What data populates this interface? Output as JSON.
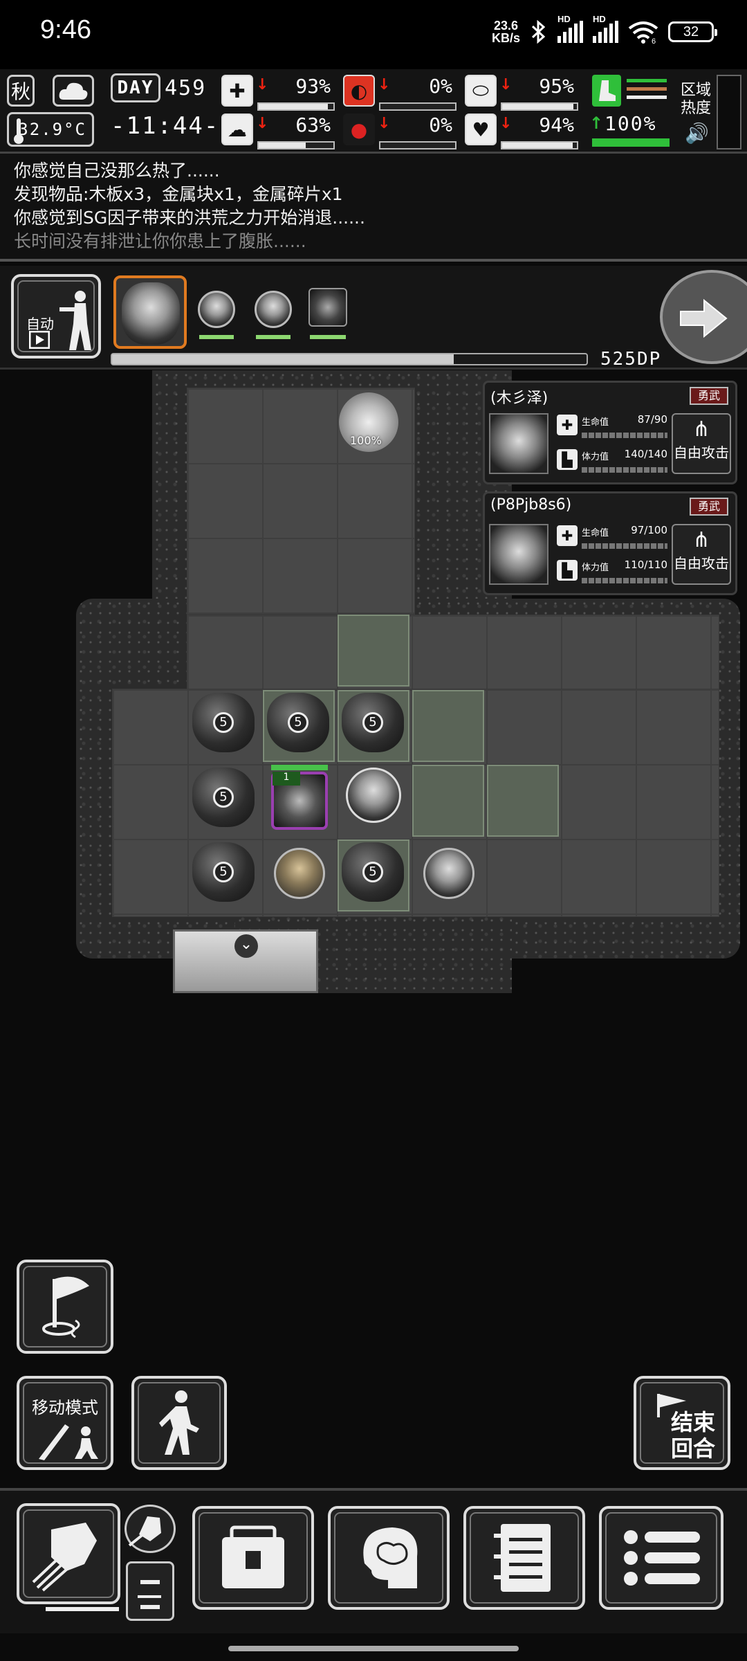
{
  "status_bar": {
    "time": "9:46",
    "speed_value": "23.6",
    "speed_unit": "KB/s",
    "sim1": "HD",
    "sim2": "HD",
    "wifi_badge": "6",
    "battery": "32"
  },
  "hud": {
    "season": "秋",
    "temperature": "32.9°C",
    "day_label": "DAY",
    "day_value": "459",
    "clock": "-11:44-",
    "stats": [
      {
        "icon": "medkit-icon",
        "value": "93%",
        "level": 0.93,
        "trend": "down"
      },
      {
        "icon": "stomach-icon",
        "value": "0%",
        "level": 0.0,
        "trend": "down"
      },
      {
        "icon": "bladder-icon",
        "value": "95%",
        "level": 0.95,
        "trend": "down"
      },
      {
        "icon": "brain-icon",
        "value": "63%",
        "level": 0.63,
        "trend": "down"
      },
      {
        "icon": "blood-drop-icon",
        "value": "0%",
        "level": 0.0,
        "trend": "down"
      },
      {
        "icon": "heart-icon",
        "value": "94%",
        "level": 0.94,
        "trend": "down"
      }
    ],
    "stamina_value": "100%",
    "stamina_level": 1.0,
    "zone_heat_label": "区域\n热度"
  },
  "log": [
    "你感觉自己没那么热了......",
    "发现物品:木板x3，金属块x1，金属碎片x1",
    "你感觉到SG因子带来的洪荒之力开始消退......",
    "长时间没有排泄让你你患上了腹胀......"
  ],
  "party": {
    "auto_label": "自动",
    "sp_value": "525DP",
    "turn_progress": 0.72
  },
  "map": {
    "loot_percent": "100%",
    "rock_number": "5",
    "enemy_level": "1"
  },
  "unit_cards": [
    {
      "name": "(木彡泽)",
      "tag": "勇武",
      "hp_label": "生命值",
      "hp": "87/90",
      "hp_level": 0.97,
      "sta_label": "体力值",
      "sta": "140/140",
      "sta_level": 1.0,
      "action": "自由攻击"
    },
    {
      "name": "(P8Pjb8s6)",
      "tag": "勇武",
      "hp_label": "生命值",
      "hp": "97/100",
      "hp_level": 0.97,
      "sta_label": "体力值",
      "sta": "110/110",
      "sta_level": 1.0,
      "action": "自由攻击"
    }
  ],
  "controls": {
    "move_mode": "移动模式",
    "end_turn": "结束\n回合"
  },
  "colors": {
    "accent_orange": "#e07a20",
    "danger_red": "#dd2211",
    "stamina_green": "#2fbf3a",
    "highlight_tile": "#5a6457"
  }
}
